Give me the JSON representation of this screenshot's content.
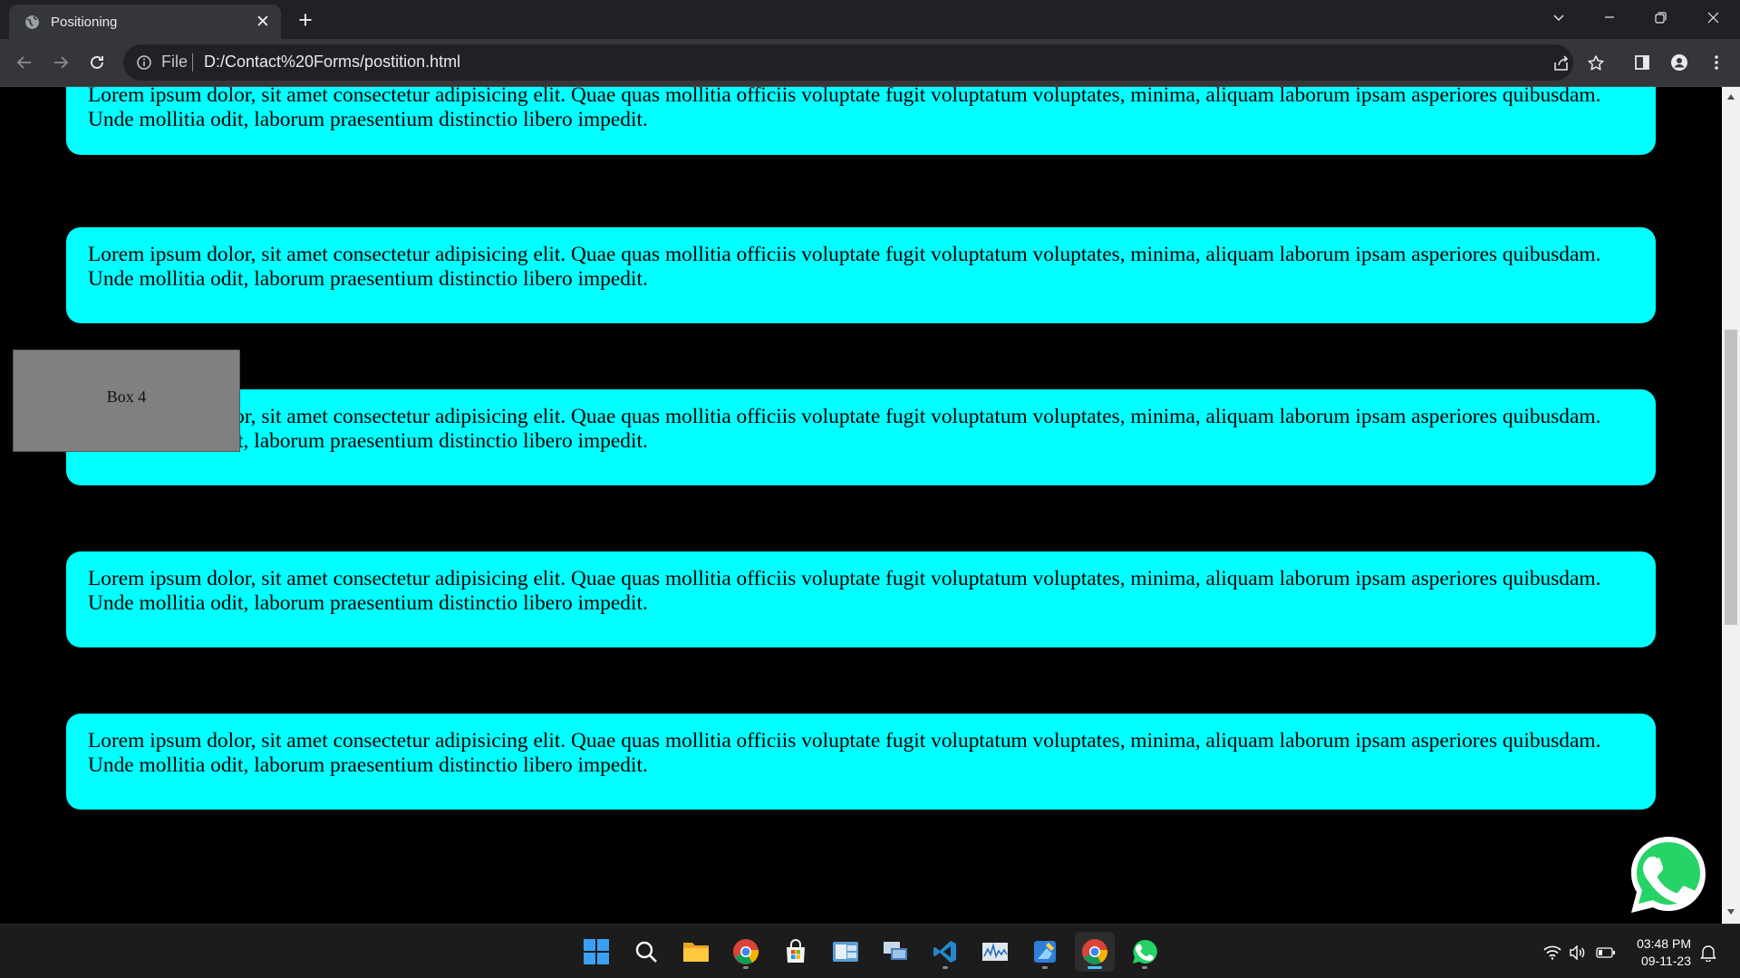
{
  "browser": {
    "tab_title": "Positioning",
    "tab_close": "✕",
    "new_tab": "+",
    "url_scheme": "File",
    "url": "D:/Contact%20Forms/postition.html"
  },
  "page": {
    "paragraph_text": "Lorem ipsum dolor, sit amet consectetur adipisicing elit. Quae quas mollitia officiis voluptate fugit voluptatum voluptates, minima, aliquam laborum ipsam asperiores quibusdam. Unde mollitia odit, laborum praesentium distinctio libero impedit.",
    "box4_label": "Box 4"
  },
  "colors": {
    "card_bg": "#00ffff",
    "page_bg": "#000000",
    "box_bg": "#808080",
    "whatsapp_green": "#25d366"
  },
  "taskbar": {
    "apps": [
      "start-icon",
      "search-icon",
      "file-explorer-icon",
      "chrome-icon",
      "microsoft-store-icon",
      "outlook-icon",
      "remote-desktop-icon",
      "vscode-icon",
      "performance-monitor-icon",
      "paint-icon",
      "chrome-active-icon",
      "whatsapp-icon"
    ],
    "time": "03:48 PM",
    "date": "09-11-23"
  }
}
